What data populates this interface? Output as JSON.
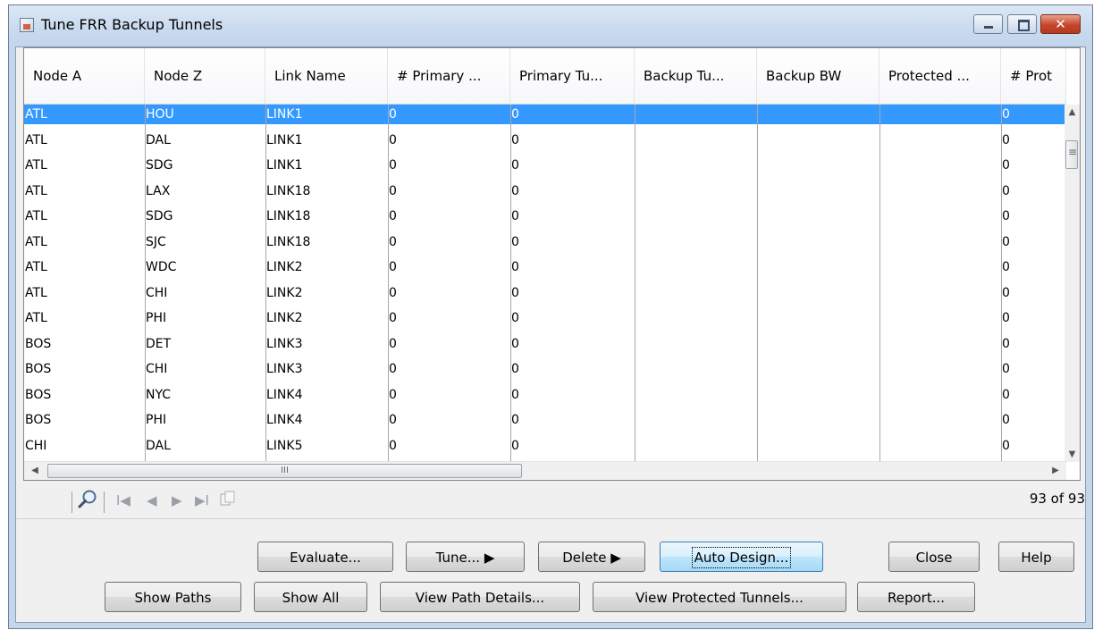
{
  "window": {
    "title": "Tune FRR Backup Tunnels",
    "close_glyph": "✕"
  },
  "table": {
    "columns": [
      "Node A",
      "Node Z",
      "Link Name",
      "# Primary ...",
      "Primary Tu...",
      "Backup Tu...",
      "Backup BW",
      "Protected ...",
      "# Prot"
    ],
    "rows": [
      [
        "ATL",
        "HOU",
        "LINK1",
        "0",
        "0",
        "",
        "",
        "",
        "0"
      ],
      [
        "ATL",
        "DAL",
        "LINK1",
        "0",
        "0",
        "",
        "",
        "",
        "0"
      ],
      [
        "ATL",
        "SDG",
        "LINK1",
        "0",
        "0",
        "",
        "",
        "",
        "0"
      ],
      [
        "ATL",
        "LAX",
        "LINK18",
        "0",
        "0",
        "",
        "",
        "",
        "0"
      ],
      [
        "ATL",
        "SDG",
        "LINK18",
        "0",
        "0",
        "",
        "",
        "",
        "0"
      ],
      [
        "ATL",
        "SJC",
        "LINK18",
        "0",
        "0",
        "",
        "",
        "",
        "0"
      ],
      [
        "ATL",
        "WDC",
        "LINK2",
        "0",
        "0",
        "",
        "",
        "",
        "0"
      ],
      [
        "ATL",
        "CHI",
        "LINK2",
        "0",
        "0",
        "",
        "",
        "",
        "0"
      ],
      [
        "ATL",
        "PHI",
        "LINK2",
        "0",
        "0",
        "",
        "",
        "",
        "0"
      ],
      [
        "BOS",
        "DET",
        "LINK3",
        "0",
        "0",
        "",
        "",
        "",
        "0"
      ],
      [
        "BOS",
        "CHI",
        "LINK3",
        "0",
        "0",
        "",
        "",
        "",
        "0"
      ],
      [
        "BOS",
        "NYC",
        "LINK4",
        "0",
        "0",
        "",
        "",
        "",
        "0"
      ],
      [
        "BOS",
        "PHI",
        "LINK4",
        "0",
        "0",
        "",
        "",
        "",
        "0"
      ],
      [
        "CHI",
        "DAL",
        "LINK5",
        "0",
        "0",
        "",
        "",
        "",
        "0"
      ]
    ],
    "selected_row": 0
  },
  "scroll": {
    "up": "▲",
    "down": "▼",
    "left": "◀",
    "right": "▶",
    "h_thumb_grip": "III"
  },
  "navigator": {
    "first": "I◀",
    "prev": "◀",
    "next": "▶",
    "last": "▶I",
    "count_text": "93 of 93"
  },
  "buttons": {
    "evaluate": "Evaluate...",
    "tune": "Tune... ▶",
    "delete": "Delete ▶",
    "auto_design": "Auto Design...",
    "close": "Close",
    "help": "Help",
    "show_paths": "Show Paths",
    "show_all": "Show All",
    "view_path_details": "View Path Details...",
    "view_protected_tunnels": "View Protected Tunnels...",
    "report": "Report..."
  },
  "colors": {
    "selection": "#3399ff",
    "close_button": "#c6452a"
  }
}
